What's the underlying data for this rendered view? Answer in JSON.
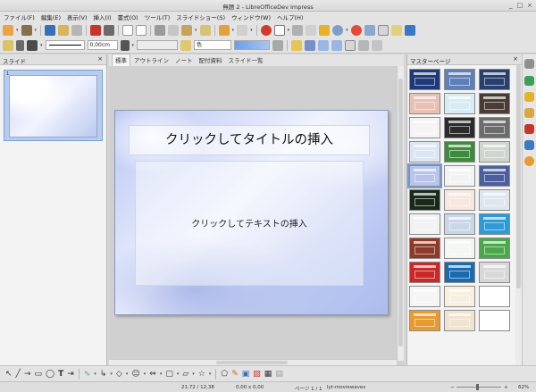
{
  "window": {
    "title": "無題 2 - LibreOfficeDev Impress",
    "buttons": [
      "_",
      "□",
      "×"
    ]
  },
  "menu": [
    "ファイル(F)",
    "編集(E)",
    "表示(V)",
    "挿入(I)",
    "書式(O)",
    "ツール(T)",
    "スライドショー(S)",
    "ウィンドウ(W)",
    "ヘルプ(H)"
  ],
  "toolbar2": {
    "line_width": "0,00cm",
    "fill_type": "色",
    "fill_color": "#6aa0e8"
  },
  "slides_pane": {
    "title": "スライド",
    "close": "×",
    "slide_number": "1"
  },
  "view_tabs": [
    "標準",
    "アウトライン",
    "ノート",
    "配付資料",
    "スライド一覧"
  ],
  "slide": {
    "title_placeholder": "クリックしてタイトルの挿入",
    "body_placeholder": "クリックしてテキストの挿入"
  },
  "master_pane": {
    "title": "マスターページ",
    "close": "×",
    "thumbnails": [
      "#1e3a78",
      "#5f7fb8",
      "#27406e",
      "#e8c0b4",
      "#d9ebf5",
      "#4a3c34",
      "#f4f4f4",
      "#2b2b2b",
      "#6c6c6c",
      "#dbe5f3",
      "#3e8a3e",
      "#cfd5cf",
      "#b8c4ea",
      "#f3f3f3",
      "#4b5f9e",
      "#1a2a1a",
      "#f7e7e0",
      "#dfe6ee",
      "#f2f2f2",
      "#c9d6e8",
      "#2e9ad6",
      "#8c3a2a",
      "#f3f7f3",
      "#4aa84a",
      "#c82828",
      "#1a6ab0",
      "#d8d8d8",
      "#f5f5f5",
      "#f7f0e0",
      "#ffffff",
      "#e89a30",
      "#f0e4d0",
      "#ffffff"
    ]
  },
  "status": {
    "position": "21,72 / 12,38",
    "size": "0,00 x 0,00",
    "page": "ページ 1 / 1",
    "master": "lyt-moviewaves",
    "zoom": "62%",
    "zoom_minus": "−",
    "zoom_plus": "+"
  }
}
